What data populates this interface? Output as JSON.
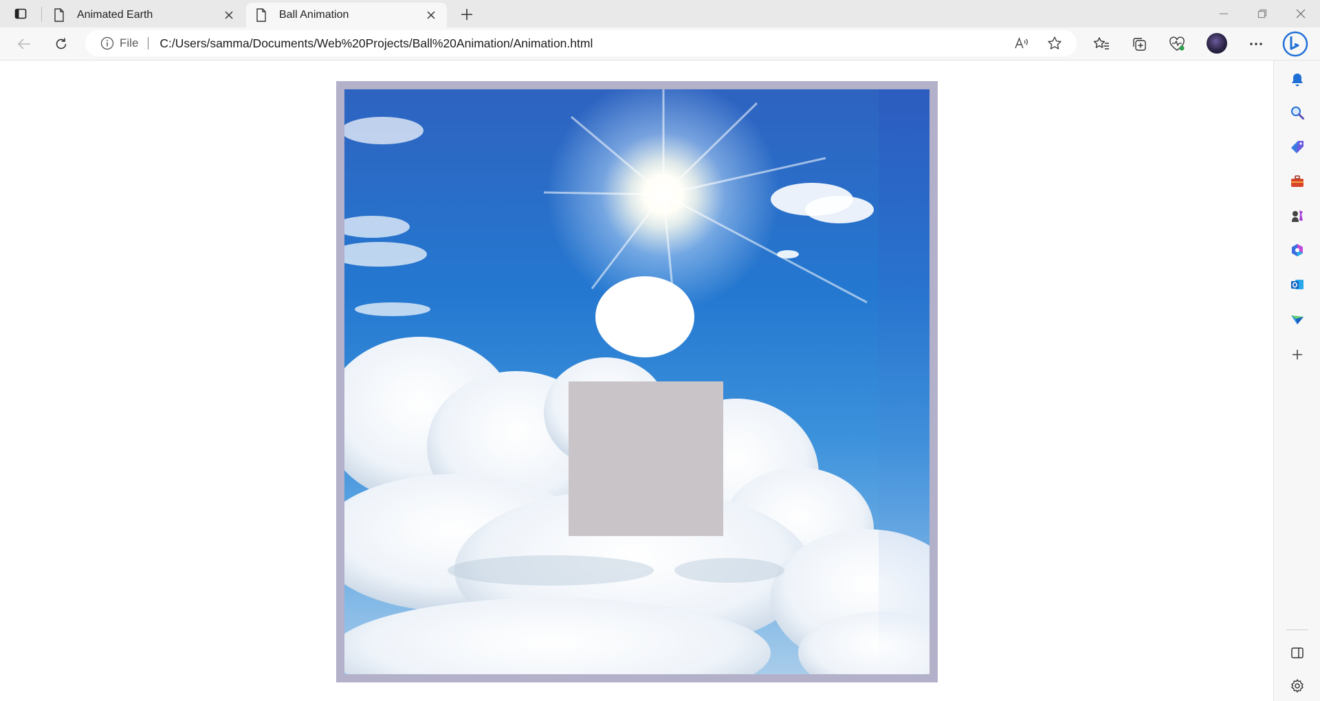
{
  "browser": {
    "tabs": [
      {
        "label": "Animated Earth",
        "active": false,
        "icon": "page-icon"
      },
      {
        "label": "Ball Animation",
        "active": true,
        "icon": "page-icon"
      }
    ],
    "address": {
      "scheme_label": "File",
      "url": "C:/Users/samma/Documents/Web%20Projects/Ball%20Animation/Animation.html"
    },
    "toolbar_icons": [
      "back-icon",
      "refresh-icon",
      "read-aloud-icon",
      "favorite-star-icon",
      "favorites-icon",
      "collections-icon",
      "browser-essentials-icon",
      "profile-avatar",
      "more-icon",
      "bing-copilot-icon"
    ],
    "sidebar_icons": [
      "notifications-icon",
      "search-icon",
      "shopping-icon",
      "tools-icon",
      "games-icon",
      "microsoft-365-icon",
      "outlook-icon",
      "drop-icon",
      "add-icon",
      "split-screen-icon",
      "settings-icon"
    ]
  },
  "page": {
    "title": "Ball Animation",
    "colors": {
      "frame": "#b3b1c9",
      "ball": "#ffffff",
      "box": "#c9c4c8",
      "sky_top": "#2e63c0",
      "sky_bottom": "#a8ccea"
    }
  }
}
